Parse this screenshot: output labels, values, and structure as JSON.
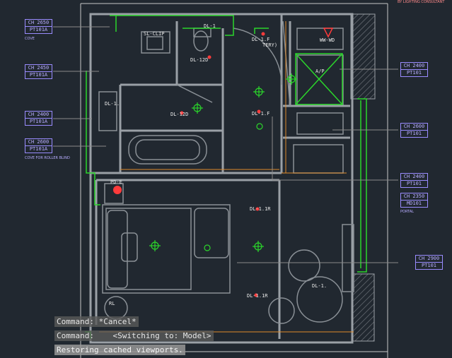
{
  "top_text": "BY LIGHTING CONSULTANT",
  "tags_left": [
    {
      "line1": "CH 2650",
      "line2": "PT101A",
      "note": "COVE"
    },
    {
      "line1": "CH 2450",
      "line2": "PT101A",
      "note": ""
    },
    {
      "line1": "CH 2400",
      "line2": "PT101A",
      "note": ""
    },
    {
      "line1": "CH 2600",
      "line2": "PT101A",
      "note": "COVE FOR ROLLER BLIND"
    }
  ],
  "tags_right": [
    {
      "line1": "CH 2400",
      "line2": "PT101",
      "note": ""
    },
    {
      "line1": "CH 2600",
      "line2": "PT101",
      "note": ""
    },
    {
      "line1": "CH 2400",
      "line2": "PT101",
      "note": ""
    },
    {
      "line1": "CH 2350",
      "line2": "MD101",
      "note": "PORTAL"
    },
    {
      "line1": "CH 2900",
      "line2": "PT101",
      "note": ""
    }
  ],
  "fixture_labels": {
    "sl_clip": "SL-CLIP",
    "dl_12d_a": "DL-12D",
    "dl_12d_b": "DL-12D",
    "dl_12d_c": "DL-12D",
    "dl_1f_top": "DL-1.F",
    "tery": "TERY)",
    "dl_1f_mid": "DL-1.F",
    "dl_1": "DL-1.",
    "ww_wd": "WW-WD",
    "ap": "A/P",
    "dl_1r_a": "DL-1.1R",
    "dl_1r_b": "DL-1.1R",
    "dl_1r_c": "DL-1.1R",
    "pd": "PD-E",
    "rl": "RL",
    "dl_bottom": "DL-1.",
    "dl_top": "DL-1"
  },
  "command_lines": [
    "Command: *Cancel*",
    "Command:    <Switching to: Model>",
    "Restoring cached viewports."
  ],
  "colors": {
    "background": "#212830",
    "walls": "#9aa0a6",
    "cove_green": "#2bd62b",
    "tag_purple": "#9a8cff",
    "fixture_red": "#ff3b3b",
    "hatch": "#7a7f86"
  }
}
